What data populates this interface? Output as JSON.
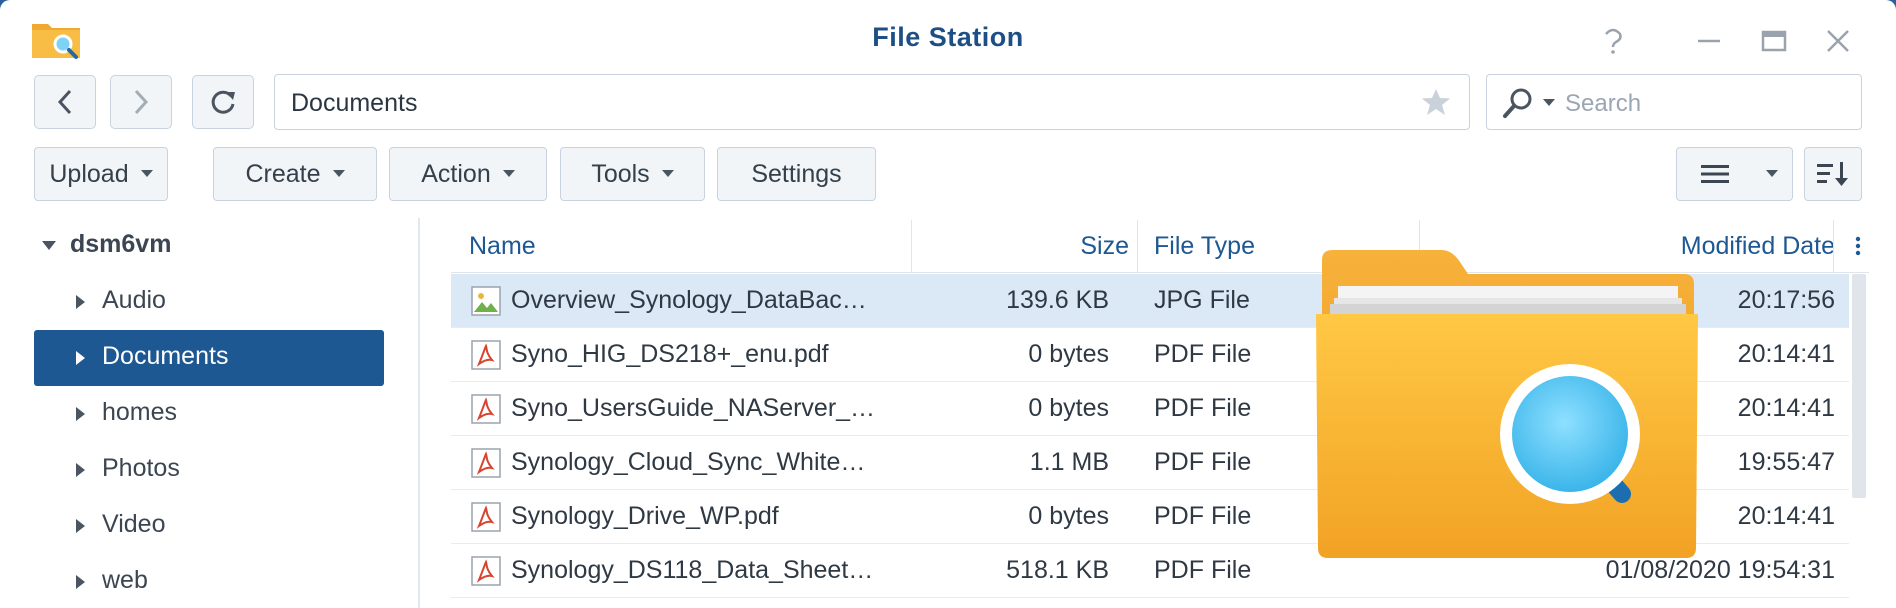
{
  "window": {
    "title": "File Station"
  },
  "nav": {
    "path": "Documents",
    "search_placeholder": "Search"
  },
  "toolbar": {
    "upload": "Upload",
    "create": "Create",
    "action": "Action",
    "tools": "Tools",
    "settings": "Settings"
  },
  "sidebar": {
    "root": "dsm6vm",
    "items": [
      {
        "label": "Audio",
        "active": false
      },
      {
        "label": "Documents",
        "active": true
      },
      {
        "label": "homes",
        "active": false
      },
      {
        "label": "Photos",
        "active": false
      },
      {
        "label": "Video",
        "active": false
      },
      {
        "label": "web",
        "active": false
      }
    ]
  },
  "table": {
    "columns": {
      "name": "Name",
      "size": "Size",
      "type": "File Type",
      "modified": "Modified Date"
    },
    "rows": [
      {
        "icon": "image-file-icon",
        "name": "Overview_Synology_DataBac…",
        "size": "139.6 KB",
        "type": "JPG File",
        "modified": "20:17:56",
        "selected": true
      },
      {
        "icon": "pdf-file-icon",
        "name": "Syno_HIG_DS218+_enu.pdf",
        "size": "0 bytes",
        "type": "PDF File",
        "modified": "20:14:41",
        "selected": false
      },
      {
        "icon": "pdf-file-icon",
        "name": "Syno_UsersGuide_NAServer_…",
        "size": "0 bytes",
        "type": "PDF File",
        "modified": "20:14:41",
        "selected": false
      },
      {
        "icon": "pdf-file-icon",
        "name": "Synology_Cloud_Sync_White…",
        "size": "1.1 MB",
        "type": "PDF File",
        "modified": "19:55:47",
        "selected": false
      },
      {
        "icon": "pdf-file-icon",
        "name": "Synology_Drive_WP.pdf",
        "size": "0 bytes",
        "type": "PDF File",
        "modified": "20:14:41",
        "selected": false
      },
      {
        "icon": "pdf-file-icon",
        "name": "Synology_DS118_Data_Sheet…",
        "size": "518.1 KB",
        "type": "PDF File",
        "modified": "01/08/2020 19:54:31",
        "selected": false
      }
    ]
  },
  "colors": {
    "accent": "#1d5893",
    "title": "#1d4f86",
    "selection": "#dbe8f6",
    "folder": "#f5a623"
  }
}
